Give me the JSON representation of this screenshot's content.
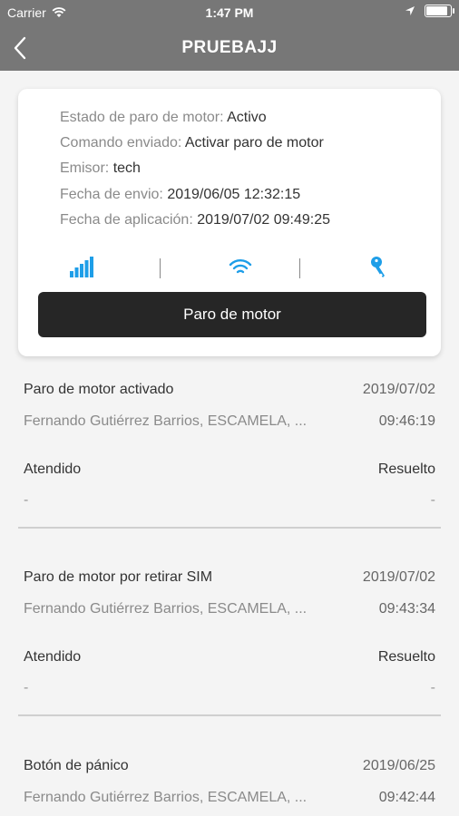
{
  "status_bar": {
    "carrier": "Carrier",
    "time": "1:47 PM"
  },
  "nav": {
    "title": "PRUEBAJJ"
  },
  "card": {
    "info": [
      {
        "label": "Estado de paro de motor:",
        "value": "Activo"
      },
      {
        "label": "Comando enviado:",
        "value": "Activar paro de motor"
      },
      {
        "label": "Emisor:",
        "value": "tech"
      },
      {
        "label": "Fecha de envio:",
        "value": "2019/06/05 12:32:15"
      },
      {
        "label": "Fecha de aplicación:",
        "value": "2019/07/02 09:49:25"
      }
    ],
    "button_label": "Paro de motor",
    "icons": [
      "signal-bars-icon",
      "wifi-icon",
      "key-icon"
    ],
    "accent_color": "#1e9ee8"
  },
  "events": [
    {
      "title": "Paro de motor activado",
      "date": "2019/07/02",
      "person": "Fernando Gutiérrez Barrios, ESCAMELA, ...",
      "time": "09:46:19",
      "left_status": "Atendido",
      "right_status": "Resuelto",
      "left_value": "-",
      "right_value": "-"
    },
    {
      "title": "Paro de motor por retirar SIM",
      "date": "2019/07/02",
      "person": "Fernando Gutiérrez Barrios, ESCAMELA, ...",
      "time": "09:43:34",
      "left_status": "Atendido",
      "right_status": "Resuelto",
      "left_value": "-",
      "right_value": "-"
    },
    {
      "title": "Botón de pánico",
      "date": "2019/06/25",
      "person": "Fernando Gutiérrez Barrios, ESCAMELA, ...",
      "time": "09:42:44"
    }
  ]
}
